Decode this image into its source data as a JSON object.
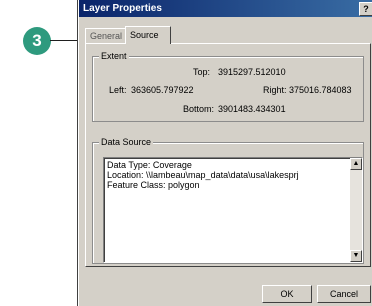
{
  "callout": {
    "number": "3"
  },
  "dialog": {
    "title": "Layer Properties",
    "help_label": "?",
    "tabs": [
      {
        "label": "General"
      },
      {
        "label": "Source"
      }
    ],
    "extent": {
      "legend": "Extent",
      "top_label": "Top:",
      "top_value": "3915297.512010",
      "left_label": "Left:",
      "left_value": "363605.797922",
      "right_label": "Right:",
      "right_value": "375016.784083",
      "bottom_label": "Bottom:",
      "bottom_value": "3901483.434301"
    },
    "data_source": {
      "legend": "Data Source",
      "lines": [
        "Data Type: Coverage",
        "Location: \\\\lambeau\\map_data\\data\\usa\\lakesprj",
        "Feature Class: polygon"
      ]
    },
    "ok_label": "OK",
    "cancel_label": "Cancel"
  }
}
